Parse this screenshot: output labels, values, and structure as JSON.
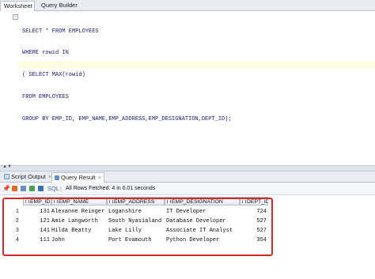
{
  "tabs": {
    "worksheet": "Worksheet",
    "query_builder": "Query Builder"
  },
  "editor": {
    "lines": [
      "SELECT * FROM EMPLOYEES",
      "WHERE rowid IN",
      "( SELECT MAX(rowid)",
      "FROM EMPLOYEES",
      "GROUP BY EMP_ID, EMP_NAME,EMP_ADDRESS,EMP_DESIGNATION,DEPT_ID);"
    ]
  },
  "output_tabs": {
    "script_output": "Script Output",
    "query_result": "Query Result",
    "close_glyph": "×"
  },
  "toolbar": {
    "sql_label": "SQL",
    "status": "All Rows Fetched: 4 in 0.01 seconds"
  },
  "results": {
    "columns": [
      "EMP_ID",
      "EMP_NAME",
      "EMP_ADDRESS",
      "EMP_DESIGNATION",
      "DEPT_ID"
    ],
    "rows": [
      {
        "num": "1",
        "emp_id": "131",
        "emp_name": "Alexanne Reinger",
        "emp_address": "Loganshire",
        "emp_designation": "IT Developer",
        "dept_id": "724"
      },
      {
        "num": "2",
        "emp_id": "121",
        "emp_name": "Amie Langworth",
        "emp_address": "South Nyasialand",
        "emp_designation": "Database Developer",
        "dept_id": "527"
      },
      {
        "num": "3",
        "emp_id": "141",
        "emp_name": "Hilda Beatty",
        "emp_address": "Lake Lilly",
        "emp_designation": "Associate IT Analyst",
        "dept_id": "527"
      },
      {
        "num": "4",
        "emp_id": "111",
        "emp_name": "John",
        "emp_address": "Port Evamouth",
        "emp_designation": "Python Developer",
        "dept_id": "354"
      }
    ]
  },
  "colors": {
    "annotation_border": "#d8292b",
    "keyword": "#2b2bb8",
    "current_line": "#fffde0"
  }
}
